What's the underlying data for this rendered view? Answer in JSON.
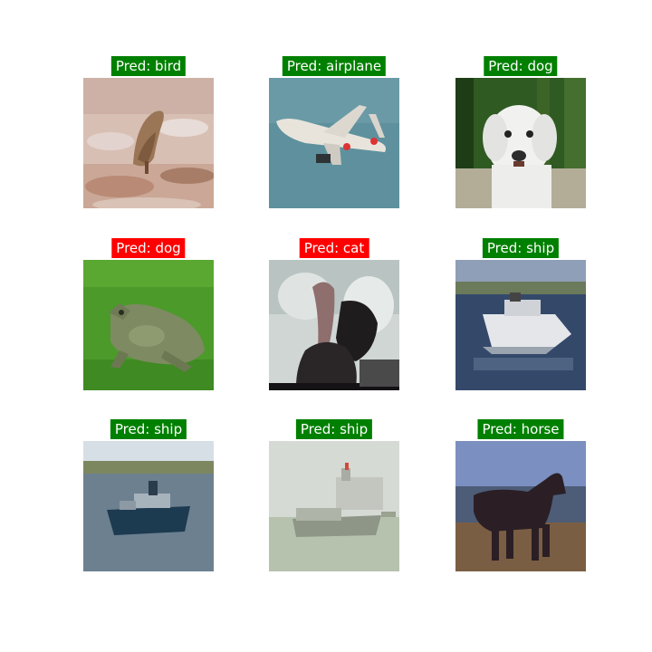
{
  "figure": {
    "panels": [
      {
        "prediction": "Pred: bird",
        "correct": true,
        "subject": "bird"
      },
      {
        "prediction": "Pred: airplane",
        "correct": true,
        "subject": "airplane"
      },
      {
        "prediction": "Pred: dog",
        "correct": true,
        "subject": "dog"
      },
      {
        "prediction": "Pred: dog",
        "correct": false,
        "subject": "frog"
      },
      {
        "prediction": "Pred: cat",
        "correct": false,
        "subject": "bird"
      },
      {
        "prediction": "Pred: ship",
        "correct": true,
        "subject": "boat"
      },
      {
        "prediction": "Pred: ship",
        "correct": true,
        "subject": "ship"
      },
      {
        "prediction": "Pred: ship",
        "correct": true,
        "subject": "ship"
      },
      {
        "prediction": "Pred: horse",
        "correct": true,
        "subject": "horse"
      }
    ],
    "colors": {
      "correct": "#008000",
      "incorrect": "#ff0000",
      "label_text": "#ffffff"
    }
  }
}
